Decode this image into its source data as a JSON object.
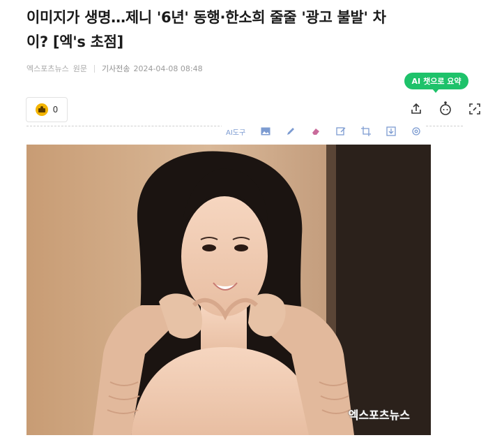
{
  "article": {
    "headline_line1": "이미지가 생명…제니 '6년' 동행·한소희 줄줄 '광고 불발' 차",
    "headline_line2": "이? [엑's 초점]",
    "press": "엑스포츠뉴스",
    "original_label": "원문",
    "sent_label": "기사전송",
    "datetime": "2024-04-08 08:48"
  },
  "ai_summary": {
    "mark": "AI",
    "label": "챗으로 요약"
  },
  "reactions": {
    "count": "0",
    "icon": "reaction-face-icon"
  },
  "actions": [
    "share-icon",
    "chatbot-icon",
    "expand-icon"
  ],
  "toolbar": {
    "ai_tool_label": "AI도구",
    "icons": [
      "image-icon",
      "pen-icon",
      "eraser-icon",
      "edit-image-icon",
      "crop-icon",
      "download-icon",
      "settings-icon"
    ]
  },
  "photo": {
    "watermark": "엑스포츠뉴스",
    "colors": {
      "background": "#c9a07c",
      "hair": "#1b1411",
      "skin": "#f3d0b8",
      "gloves": "#e2b99c"
    }
  }
}
